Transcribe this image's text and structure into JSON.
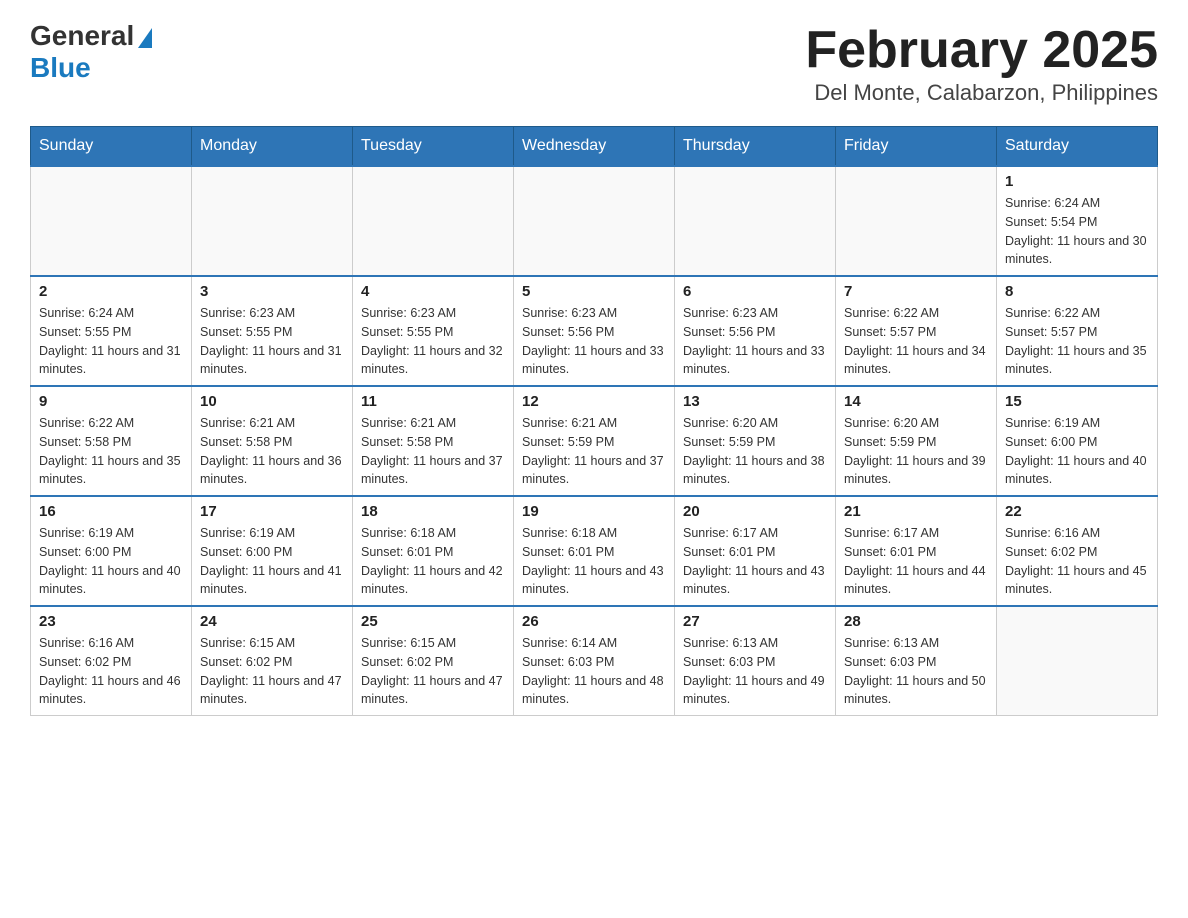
{
  "header": {
    "logo_general": "General",
    "logo_blue": "Blue",
    "title": "February 2025",
    "subtitle": "Del Monte, Calabarzon, Philippines"
  },
  "days_of_week": [
    "Sunday",
    "Monday",
    "Tuesday",
    "Wednesday",
    "Thursday",
    "Friday",
    "Saturday"
  ],
  "weeks": [
    [
      {
        "day": "",
        "info": ""
      },
      {
        "day": "",
        "info": ""
      },
      {
        "day": "",
        "info": ""
      },
      {
        "day": "",
        "info": ""
      },
      {
        "day": "",
        "info": ""
      },
      {
        "day": "",
        "info": ""
      },
      {
        "day": "1",
        "info": "Sunrise: 6:24 AM\nSunset: 5:54 PM\nDaylight: 11 hours and 30 minutes."
      }
    ],
    [
      {
        "day": "2",
        "info": "Sunrise: 6:24 AM\nSunset: 5:55 PM\nDaylight: 11 hours and 31 minutes."
      },
      {
        "day": "3",
        "info": "Sunrise: 6:23 AM\nSunset: 5:55 PM\nDaylight: 11 hours and 31 minutes."
      },
      {
        "day": "4",
        "info": "Sunrise: 6:23 AM\nSunset: 5:55 PM\nDaylight: 11 hours and 32 minutes."
      },
      {
        "day": "5",
        "info": "Sunrise: 6:23 AM\nSunset: 5:56 PM\nDaylight: 11 hours and 33 minutes."
      },
      {
        "day": "6",
        "info": "Sunrise: 6:23 AM\nSunset: 5:56 PM\nDaylight: 11 hours and 33 minutes."
      },
      {
        "day": "7",
        "info": "Sunrise: 6:22 AM\nSunset: 5:57 PM\nDaylight: 11 hours and 34 minutes."
      },
      {
        "day": "8",
        "info": "Sunrise: 6:22 AM\nSunset: 5:57 PM\nDaylight: 11 hours and 35 minutes."
      }
    ],
    [
      {
        "day": "9",
        "info": "Sunrise: 6:22 AM\nSunset: 5:58 PM\nDaylight: 11 hours and 35 minutes."
      },
      {
        "day": "10",
        "info": "Sunrise: 6:21 AM\nSunset: 5:58 PM\nDaylight: 11 hours and 36 minutes."
      },
      {
        "day": "11",
        "info": "Sunrise: 6:21 AM\nSunset: 5:58 PM\nDaylight: 11 hours and 37 minutes."
      },
      {
        "day": "12",
        "info": "Sunrise: 6:21 AM\nSunset: 5:59 PM\nDaylight: 11 hours and 37 minutes."
      },
      {
        "day": "13",
        "info": "Sunrise: 6:20 AM\nSunset: 5:59 PM\nDaylight: 11 hours and 38 minutes."
      },
      {
        "day": "14",
        "info": "Sunrise: 6:20 AM\nSunset: 5:59 PM\nDaylight: 11 hours and 39 minutes."
      },
      {
        "day": "15",
        "info": "Sunrise: 6:19 AM\nSunset: 6:00 PM\nDaylight: 11 hours and 40 minutes."
      }
    ],
    [
      {
        "day": "16",
        "info": "Sunrise: 6:19 AM\nSunset: 6:00 PM\nDaylight: 11 hours and 40 minutes."
      },
      {
        "day": "17",
        "info": "Sunrise: 6:19 AM\nSunset: 6:00 PM\nDaylight: 11 hours and 41 minutes."
      },
      {
        "day": "18",
        "info": "Sunrise: 6:18 AM\nSunset: 6:01 PM\nDaylight: 11 hours and 42 minutes."
      },
      {
        "day": "19",
        "info": "Sunrise: 6:18 AM\nSunset: 6:01 PM\nDaylight: 11 hours and 43 minutes."
      },
      {
        "day": "20",
        "info": "Sunrise: 6:17 AM\nSunset: 6:01 PM\nDaylight: 11 hours and 43 minutes."
      },
      {
        "day": "21",
        "info": "Sunrise: 6:17 AM\nSunset: 6:01 PM\nDaylight: 11 hours and 44 minutes."
      },
      {
        "day": "22",
        "info": "Sunrise: 6:16 AM\nSunset: 6:02 PM\nDaylight: 11 hours and 45 minutes."
      }
    ],
    [
      {
        "day": "23",
        "info": "Sunrise: 6:16 AM\nSunset: 6:02 PM\nDaylight: 11 hours and 46 minutes."
      },
      {
        "day": "24",
        "info": "Sunrise: 6:15 AM\nSunset: 6:02 PM\nDaylight: 11 hours and 47 minutes."
      },
      {
        "day": "25",
        "info": "Sunrise: 6:15 AM\nSunset: 6:02 PM\nDaylight: 11 hours and 47 minutes."
      },
      {
        "day": "26",
        "info": "Sunrise: 6:14 AM\nSunset: 6:03 PM\nDaylight: 11 hours and 48 minutes."
      },
      {
        "day": "27",
        "info": "Sunrise: 6:13 AM\nSunset: 6:03 PM\nDaylight: 11 hours and 49 minutes."
      },
      {
        "day": "28",
        "info": "Sunrise: 6:13 AM\nSunset: 6:03 PM\nDaylight: 11 hours and 50 minutes."
      },
      {
        "day": "",
        "info": ""
      }
    ]
  ]
}
